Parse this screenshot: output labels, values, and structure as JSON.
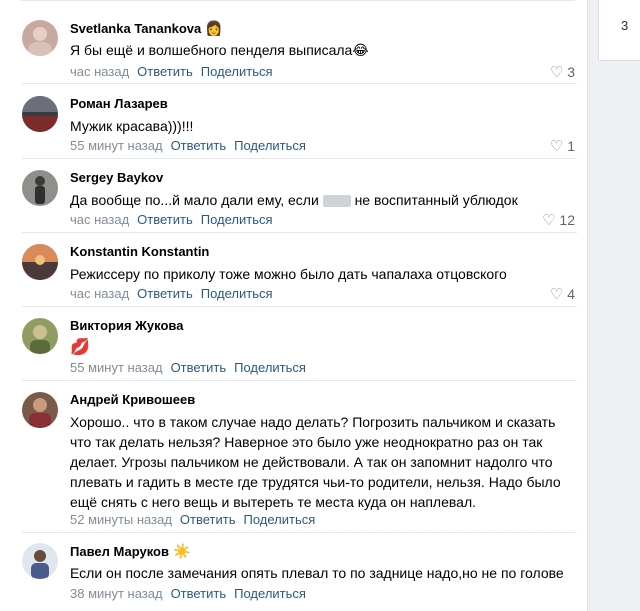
{
  "right_panel": {
    "glyph": "3"
  },
  "comments": [
    {
      "author": "Svetlanka Tanankova",
      "badge": "👩",
      "text": "Я бы ещё и волшебного пенделя выписала😂",
      "time": "час назад",
      "reply": "Ответить",
      "share": "Поделиться",
      "likes": "3",
      "avatar_color": "#c8a9a0"
    },
    {
      "author": "Роман Лазарев",
      "text": "Мужик красава)))!!!",
      "time": "55 минут назад",
      "reply": "Ответить",
      "share": "Поделиться",
      "likes": "1",
      "avatar_color": "#3b3a3f"
    },
    {
      "author": "Sergey Baykov",
      "text_a": "Да вообще по...й мало дали ему, если",
      "text_b": "не воспитанный ублюдок",
      "time": "час назад",
      "reply": "Ответить",
      "share": "Поделиться",
      "likes": "12",
      "avatar_color": "#6e6f6a"
    },
    {
      "author": "Konstantin Konstantin",
      "text": "Режиссеру по приколу тоже можно было дать чапалаха отцовского",
      "time": "час назад",
      "reply": "Ответить",
      "share": "Поделиться",
      "likes": "4",
      "avatar_color": "#b3624a"
    },
    {
      "author": "Виктория Жукова",
      "text": "💋",
      "time": "55 минут назад",
      "reply": "Ответить",
      "share": "Поделиться",
      "likes": "",
      "avatar_color": "#8f9c63"
    },
    {
      "author": "Андрей Кривошеев",
      "text": "Хорошо.. что в таком случае надо делать? Погрозить пальчиком и сказать что так делать нельзя? Наверное это было уже неоднократно раз он так делает. Угрозы пальчиком не действовали. А так он запомнит надолго что плевать и гадить в месте где трудятся чьи-то родители, нельзя. Надо было ещё снять с него вещь и вытереть те места куда он наплевал.",
      "time": "52 минуты назад",
      "reply": "Ответить",
      "share": "Поделиться",
      "likes": "",
      "avatar_color": "#7a5a48"
    },
    {
      "author": "Павел Маруков",
      "badge": "☀️",
      "text": "Если он после замечания опять плевал то по заднице надо,но не по голове",
      "time": "38 минут назад",
      "reply": "Ответить",
      "share": "Поделиться",
      "likes": "",
      "avatar_color": "#a9b7c6"
    }
  ]
}
